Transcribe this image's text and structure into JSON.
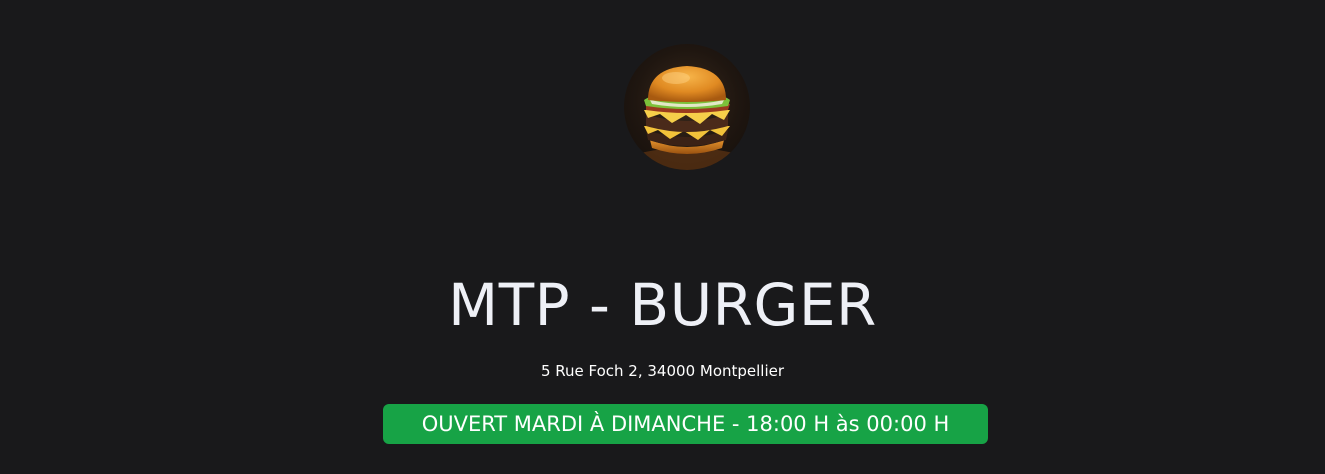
{
  "restaurant": {
    "logo_icon": "burger-logo-icon",
    "name": "MTP - BURGER",
    "address": "5 Rue Foch 2, 34000 Montpellier",
    "hours_badge": "OUVERT MARDI À DIMANCHE - 18:00 H às 00:00 H"
  },
  "colors": {
    "background": "#19191b",
    "title_text": "#eef0f6",
    "badge": "#17a346",
    "badge_text": "#ffffff"
  }
}
